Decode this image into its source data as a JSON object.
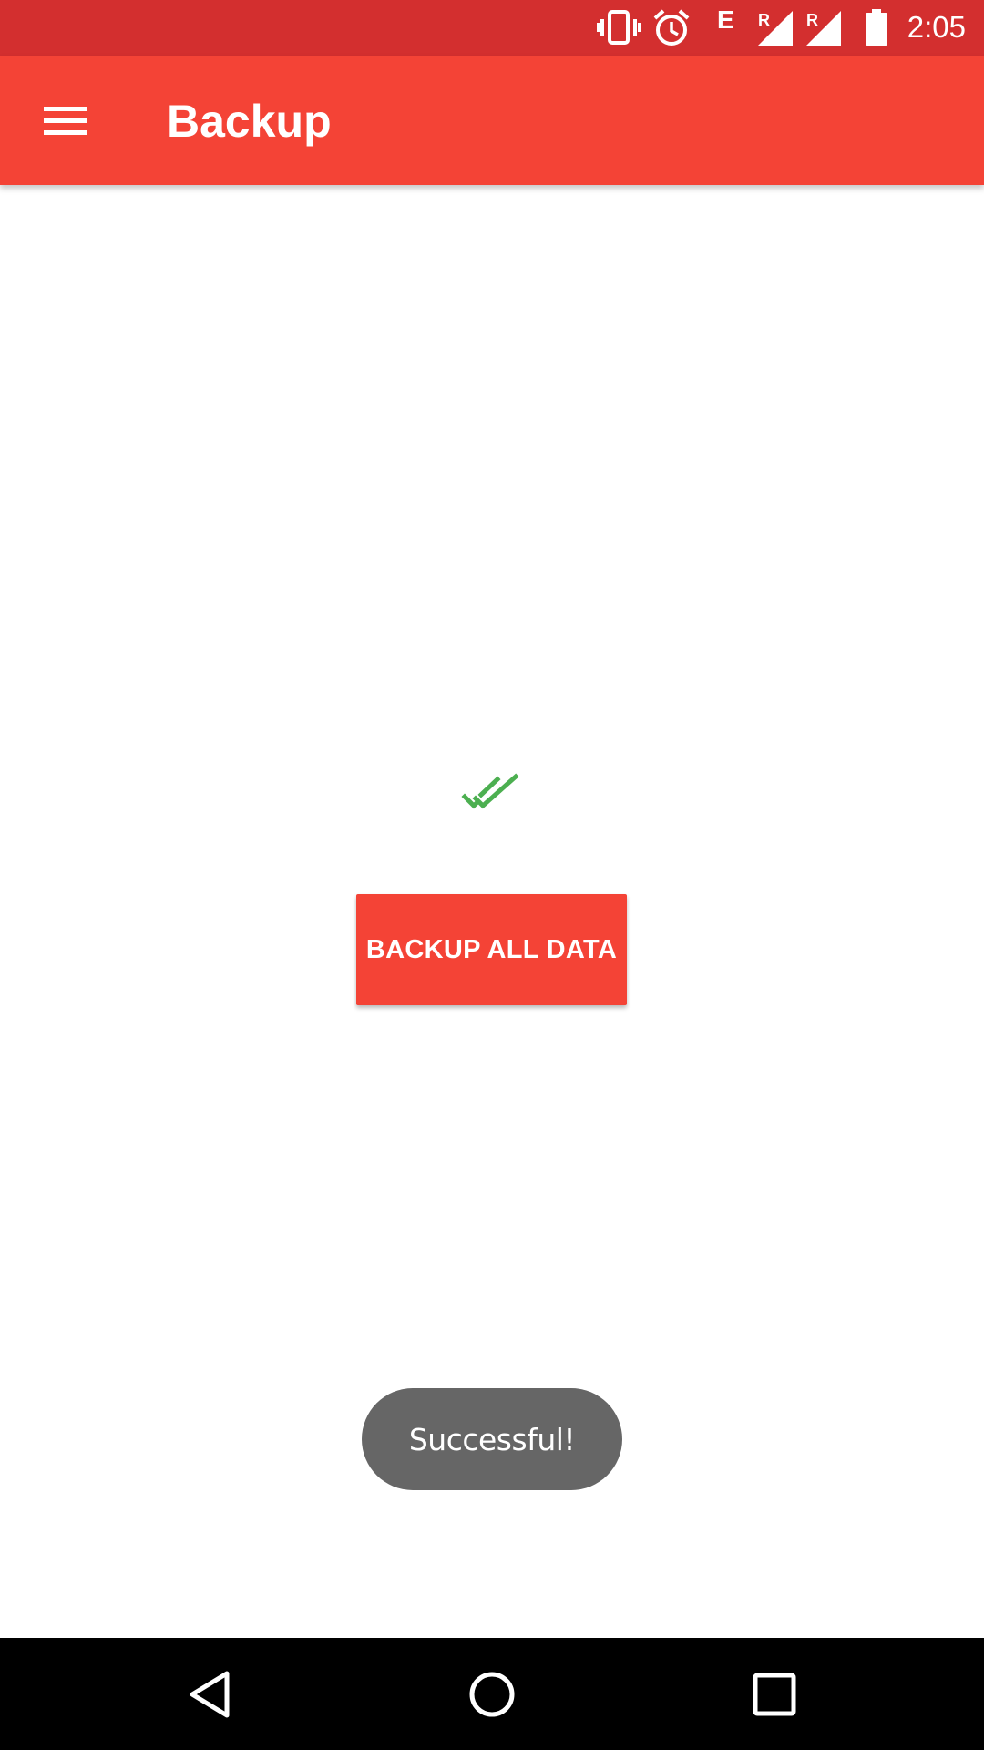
{
  "status_bar": {
    "time": "2:05",
    "network_type": "E",
    "roaming_label_1": "R",
    "roaming_label_2": "R",
    "icons": [
      "vibrate-icon",
      "alarm-icon",
      "signal-icon",
      "signal-icon",
      "battery-icon"
    ]
  },
  "app_bar": {
    "title": "Backup",
    "menu_icon": "menu-icon"
  },
  "main": {
    "status_icon": "double-check-icon",
    "backup_button_label": "BACKUP ALL DATA"
  },
  "toast": {
    "message": "Successful!"
  },
  "nav_bar": {
    "icons": [
      "back-icon",
      "home-icon",
      "recents-icon"
    ]
  },
  "colors": {
    "status_bar": "#d32f2f",
    "app_bar": "#f44336",
    "accent": "#f44336",
    "success": "#4caf50",
    "toast": "#666666",
    "nav_bar": "#000000"
  }
}
